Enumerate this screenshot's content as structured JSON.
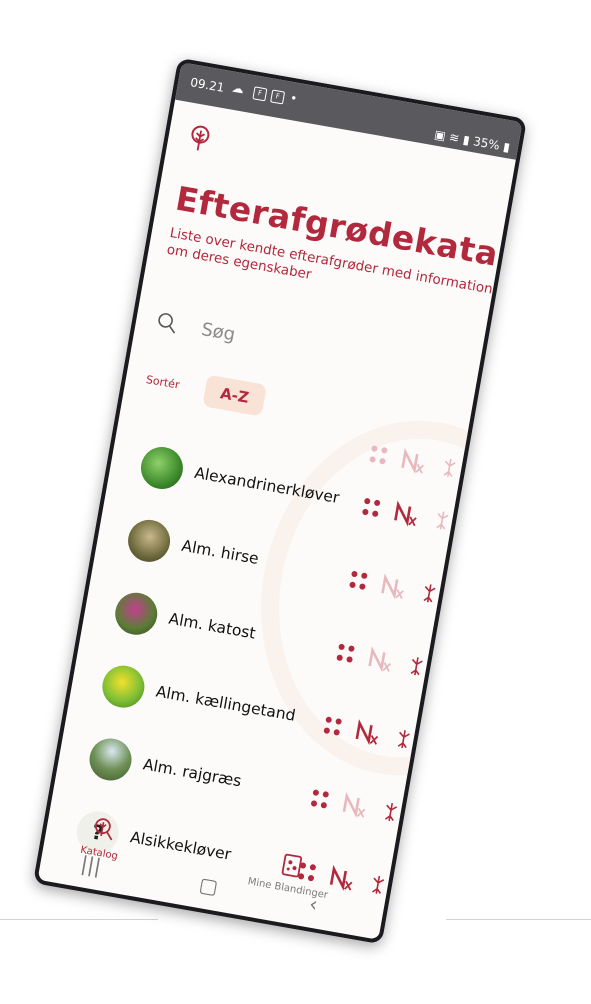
{
  "status": {
    "time": "09.21",
    "right_text": "35%"
  },
  "header": {
    "title": "Efterafgrødekatalog",
    "subtitle": "Liste over kendte efterafgrøder med information om deres egenskaber"
  },
  "search": {
    "placeholder": "Søg"
  },
  "sort": {
    "label": "Sortér",
    "value": "A-Z"
  },
  "items": [
    {
      "name": "Alexandrinerkløver",
      "img": "clover",
      "icon_state": [
        1,
        1,
        0
      ]
    },
    {
      "name": "Alm. hirse",
      "img": "grass",
      "icon_state": [
        1,
        0,
        1
      ]
    },
    {
      "name": "Alm. katost",
      "img": "mallow",
      "icon_state": [
        1,
        0,
        1
      ]
    },
    {
      "name": "Alm. kællingetand",
      "img": "yellow",
      "icon_state": [
        1,
        1,
        1
      ]
    },
    {
      "name": "Alm. rajgræs",
      "img": "rye",
      "icon_state": [
        1,
        0,
        1
      ]
    },
    {
      "name": "Alsikkekløver",
      "img": "unknown",
      "icon_state": [
        1,
        1,
        1
      ]
    }
  ],
  "nav": {
    "left_label": "Katalog",
    "right_label": "Mine Blandinger"
  },
  "colors": {
    "brand": "#b2283d",
    "chip": "#f9e2d6",
    "faded": "#e7b9be"
  }
}
